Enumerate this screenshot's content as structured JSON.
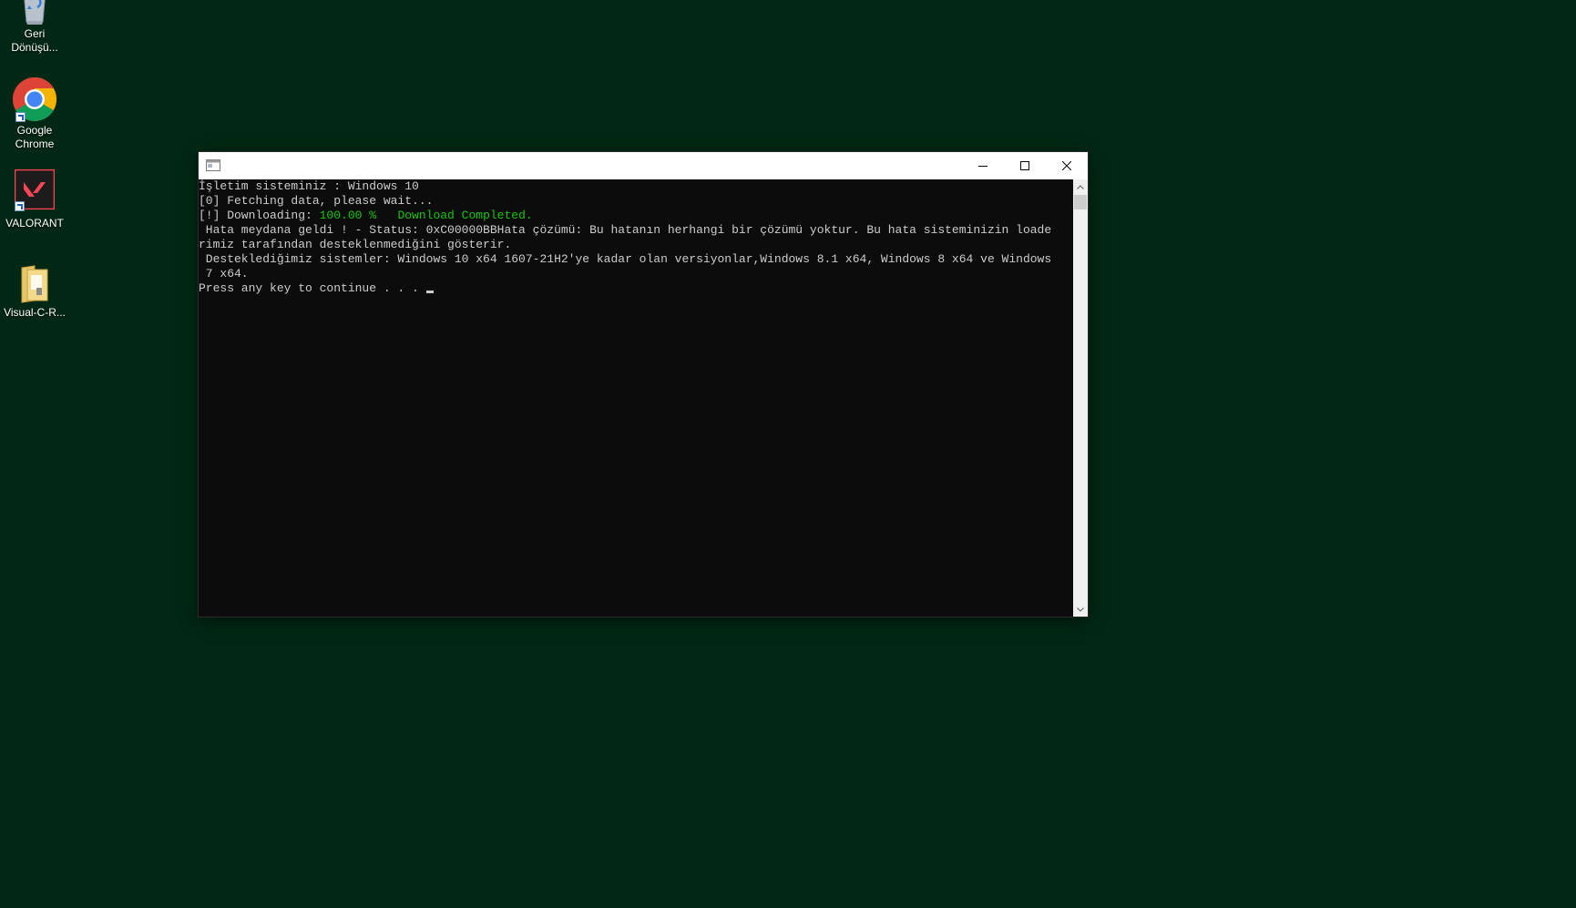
{
  "desktop": {
    "background_color": "#002814",
    "icons": [
      {
        "label": "Geri Dönüşü...",
        "icon": "recycle-bin-icon"
      },
      {
        "label": "Google Chrome",
        "icon": "chrome-icon"
      },
      {
        "label": "VALORANT",
        "icon": "valorant-icon"
      },
      {
        "label": "Visual-C-R...",
        "icon": "folder-icon"
      }
    ]
  },
  "console": {
    "title": "",
    "controls": {
      "minimize": "minimize-icon",
      "maximize": "maximize-icon",
      "close": "close-icon"
    },
    "lines": {
      "os_line": "İşletim sisteminiz : Windows 10",
      "fetch_line": "[0] Fetching data, please wait...",
      "download_prefix": "[!] Downloading: ",
      "download_percent": "100.00 %",
      "download_status": "   Download Completed.",
      "error_line1": " Hata meydana geldi ! - Status: 0xC00000BBHata çözümü: Bu hatanın herhangi bir çözümü yoktur. Bu hata sisteminizin loade",
      "error_line2": "rimiz tarafından desteklenmediğini gösterir.",
      "support_line1": " Desteklediğimiz sistemler: Windows 10 x64 1607-21H2'ye kadar olan versiyonlar,Windows 8.1 x64, Windows 8 x64 ve Windows",
      "support_line2": " 7 x64.",
      "prompt_line": "Press any key to continue . . . "
    },
    "text_color": "#cccccc",
    "highlight_color": "#16c60c",
    "background_color": "#0c0c0c"
  }
}
